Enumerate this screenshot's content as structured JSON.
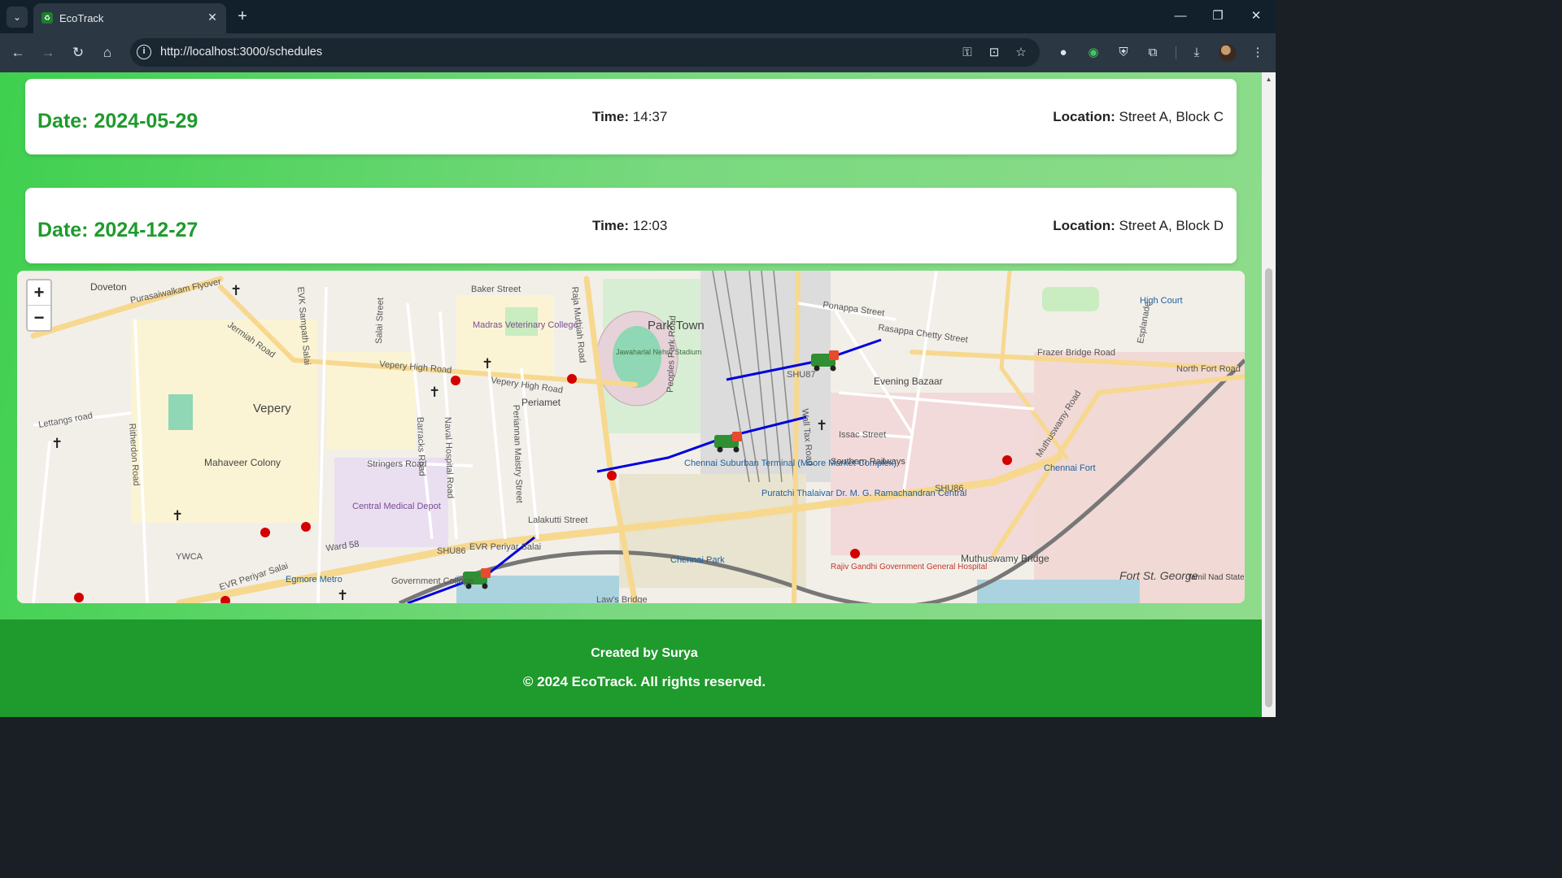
{
  "browser": {
    "tab_title": "EcoTrack",
    "url": "http://localhost:3000/schedules",
    "tab_favicon_glyph": "♻"
  },
  "schedules": [
    {
      "date_label": "Date: 2024-05-29",
      "time_label": "Time:",
      "time": "14:37",
      "location_label": "Location:",
      "location": "Street A, Block C"
    },
    {
      "date_label": "Date: 2024-12-27",
      "time_label": "Time:",
      "time": "12:03",
      "location_label": "Location:",
      "location": "Street A, Block D"
    }
  ],
  "map": {
    "zoom_in": "+",
    "zoom_out": "−",
    "labels": {
      "park_town": "Park Town",
      "vepery": "Vepery",
      "periamet": "Periamet",
      "doveton": "Doveton",
      "mahaveer_colony": "Mahaveer Colony",
      "central_medical_depot": "Central Medical Depot",
      "madras_veterinary": "Madras Veterinary College",
      "stadium": "Jawaharlal Nehru Stadium",
      "chennai_suburban": "Chennai Suburban Terminal (Moore Market Complex)",
      "puratchi": "Puratchi Thalaivar Dr. M. G. Ramachandran Central",
      "chennai_park": "Chennai Park",
      "egmore_metro": "Egmore Metro",
      "rajiv_gandhi": "Rajiv Gandhi Government General Hospital",
      "muthuswamy_bridge": "Muthuswamy Bridge",
      "fort_st_george": "Fort St. George",
      "chennai_fort": "Chennai Fort",
      "high_court": "High Court",
      "evening_bazaar": "Evening Bazaar",
      "southern_railways": "Southern Railways",
      "tamil_nadu_leg": "Tamil Nad State Legisl",
      "government_college": "Government College",
      "ywca": "YWCA",
      "pursaiwalkam": "Purasaiwalkam Flyover",
      "jermiah": "Jermiah Road",
      "vepery_high_road_1": "Vepery High Road",
      "vepery_high_road_2": "Vepery High Road",
      "baker_street": "Baker Street",
      "raja_muthiah": "Raja Muthiah Road",
      "evk_sampath": "EVK Sampath Salai",
      "stringers": "Stringers Road",
      "lettangs": "Lettangs road",
      "ritherdon": "Ritherdon Road",
      "evr_periyar_1": "EVR Periyar Salai",
      "evr_periyar_2": "EVR Periyar Salai",
      "shu86_1": "SHU86",
      "shu86_2": "SHU86",
      "shu87": "SHU87",
      "ward58": "Ward 58",
      "ponappa": "Ponappa Street",
      "rasappa": "Rasappa Chetty Street",
      "frazer": "Frazer Bridge Road",
      "north_fort": "North Fort Road",
      "issac": "Issac Street",
      "wall_tax": "Wall Tax Road",
      "lalakutti": "Lalakutti Street",
      "muthuswamy_road": "Muthuswamy Road",
      "salai_street": "Salai Street",
      "peoples_park": "Peoples Park Road",
      "barracks": "Barracks Road",
      "naval_hospital": "Naval Hospital Road",
      "periannan": "Periannan Maistry Street",
      "laws_bridge": "Law's Bridge",
      "esplanade": "Esplanade"
    }
  },
  "footer": {
    "credit": "Created by Surya",
    "copyright": "© 2024 EcoTrack. All rights reserved."
  }
}
